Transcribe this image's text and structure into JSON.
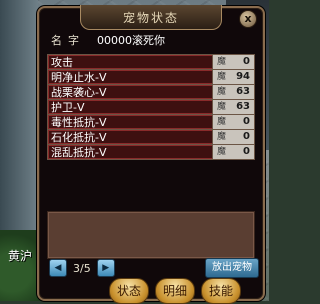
{
  "window": {
    "title": "宠物状态",
    "close_glyph": "x"
  },
  "pet": {
    "name_label": "名字",
    "name_value": "00000滚死你"
  },
  "skills": [
    {
      "name": "攻击",
      "tag": "魔",
      "value": "0"
    },
    {
      "name": "明净止水-V",
      "tag": "魔",
      "value": "94"
    },
    {
      "name": "战栗袭心-V",
      "tag": "魔",
      "value": "63"
    },
    {
      "name": "护卫-V",
      "tag": "魔",
      "value": "63"
    },
    {
      "name": "毒性抵抗-V",
      "tag": "魔",
      "value": "0"
    },
    {
      "name": "石化抵抗-V",
      "tag": "魔",
      "value": "0"
    },
    {
      "name": "混乱抵抗-V",
      "tag": "魔",
      "value": "0"
    }
  ],
  "pager": {
    "prev_glyph": "◀",
    "next_glyph": "▶",
    "page_text": "3/5"
  },
  "release_button": "放出宠物",
  "tabs": [
    "状态",
    "明细",
    "技能"
  ],
  "scene": {
    "label": "黄沪"
  },
  "colors": {
    "row_bg": "#3e1010",
    "row_border": "#8a2a2a",
    "accent_gold": "#c8902c",
    "button_blue": "#3e8ab6"
  }
}
